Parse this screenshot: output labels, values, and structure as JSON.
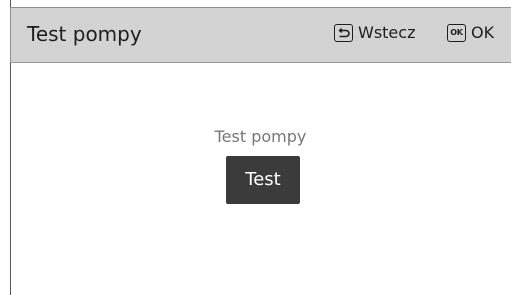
{
  "header": {
    "title": "Test pompy",
    "back_label": "Wstecz",
    "ok_key_label": "OK",
    "ok_label": "OK"
  },
  "main": {
    "field_label": "Test pompy",
    "test_button_label": "Test"
  },
  "icons": {
    "back": "back-arrow-icon",
    "ok": "ok-key-icon"
  },
  "colors": {
    "header_bg": "#d3d3d3",
    "button_bg": "#3b3b3b",
    "label_gray": "#777777"
  }
}
